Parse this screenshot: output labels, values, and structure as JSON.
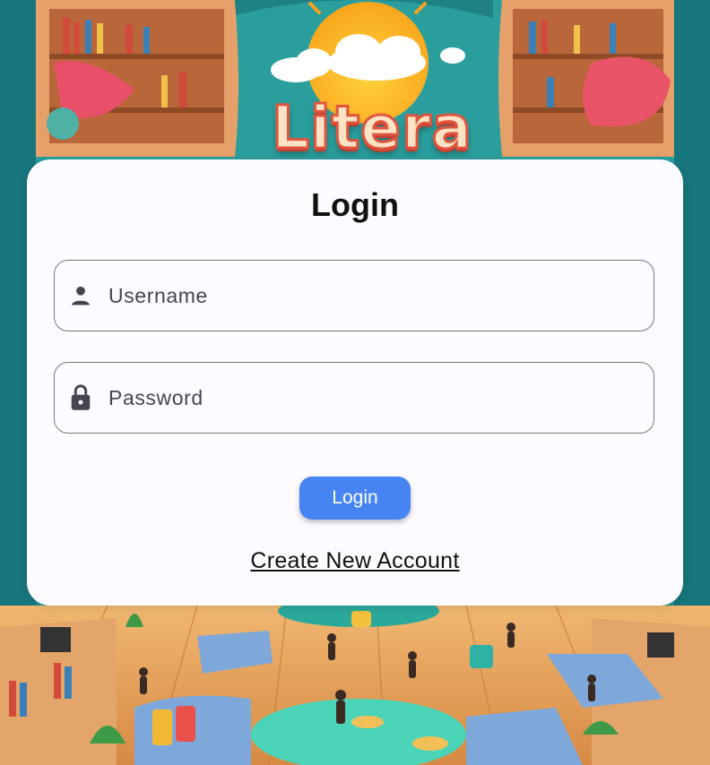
{
  "background": {
    "brand_text": "Litera"
  },
  "login_card": {
    "title": "Login",
    "username": {
      "placeholder": "Username",
      "value": "",
      "icon": "person-icon"
    },
    "password": {
      "placeholder": "Password",
      "value": "",
      "icon": "lock-icon"
    },
    "login_button_label": "Login",
    "create_account_link": "Create New Account"
  },
  "colors": {
    "accent": "#4784f3",
    "card_background": "#fdfbff",
    "field_border": "#7a7775",
    "icon": "#46464f"
  }
}
